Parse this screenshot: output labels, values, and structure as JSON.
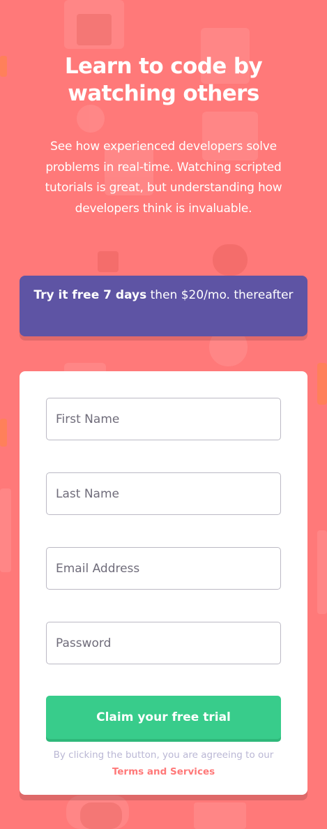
{
  "hero": {
    "title": "Learn to code by watching others",
    "subtitle": "See how experienced developers solve problems in real-time. Watching scripted tutorials is great, but understanding how developers think is invaluable."
  },
  "promo": {
    "bold_text": "Try it free 7 days",
    "rest_text": " then $20/mo. thereafter"
  },
  "form": {
    "first_name_placeholder": "First Name",
    "last_name_placeholder": "Last Name",
    "email_placeholder": "Email Address",
    "password_placeholder": "Password",
    "submit_label": "Claim your free trial",
    "terms_prefix": "By clicking the button, you are agreeing to our ",
    "terms_link": "Terms and Services"
  },
  "colors": {
    "background": "#ff7979",
    "promo": "#5e54a4",
    "accent_green": "#38cc8b",
    "terms_text": "#bab7d4"
  }
}
